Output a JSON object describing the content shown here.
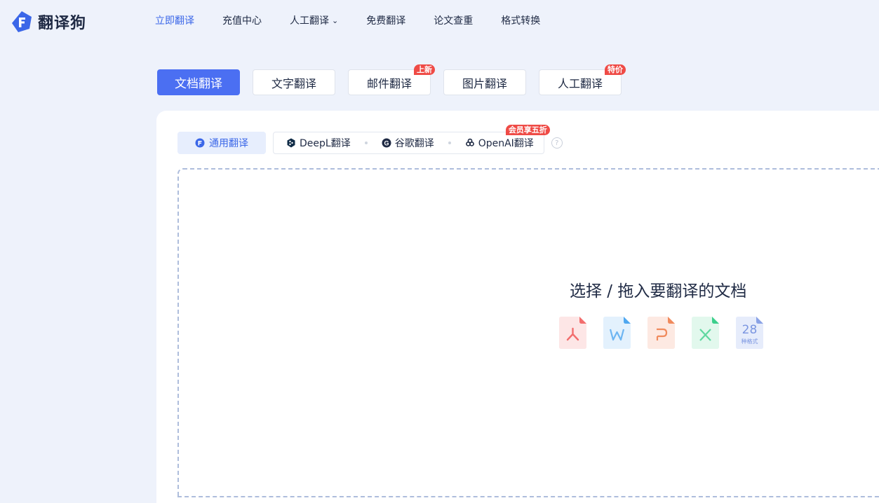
{
  "brand": {
    "name": "翻译狗",
    "logo_icon": "f-diamond-logo",
    "color": "#3b67e8"
  },
  "nav": {
    "items": [
      {
        "label": "立即翻译",
        "active": true
      },
      {
        "label": "充值中心"
      },
      {
        "label": "人工翻译",
        "has_dropdown": true
      },
      {
        "label": "免费翻译"
      },
      {
        "label": "论文查重"
      },
      {
        "label": "格式转换"
      }
    ]
  },
  "mode_tabs": [
    {
      "label": "文档翻译",
      "active": true
    },
    {
      "label": "文字翻译"
    },
    {
      "label": "邮件翻译",
      "badge": "上新"
    },
    {
      "label": "图片翻译"
    },
    {
      "label": "人工翻译",
      "badge": "特价"
    }
  ],
  "engines": {
    "general": "通用翻译",
    "options": [
      {
        "label": "DeepL翻译",
        "icon": "deepl-icon"
      },
      {
        "label": "谷歌翻译",
        "icon": "google-icon"
      },
      {
        "label": "OpenAI翻译",
        "icon": "openai-icon"
      }
    ],
    "member_badge": "会员享五折",
    "help": "?"
  },
  "dropzone": {
    "title": "选择 / 拖入要翻译的文档",
    "formats": [
      {
        "icon": "pdf-icon",
        "color": "#f26d6d"
      },
      {
        "icon": "word-icon",
        "color": "#4fa7f0"
      },
      {
        "icon": "ppt-icon",
        "color": "#f08a5d"
      },
      {
        "icon": "excel-icon",
        "color": "#3ccf8c"
      }
    ],
    "more_count": "28",
    "more_label": "种格式"
  },
  "colors": {
    "accent": "#4b6ff2",
    "badge": "#ef4b46",
    "background": "#eef2fb"
  }
}
